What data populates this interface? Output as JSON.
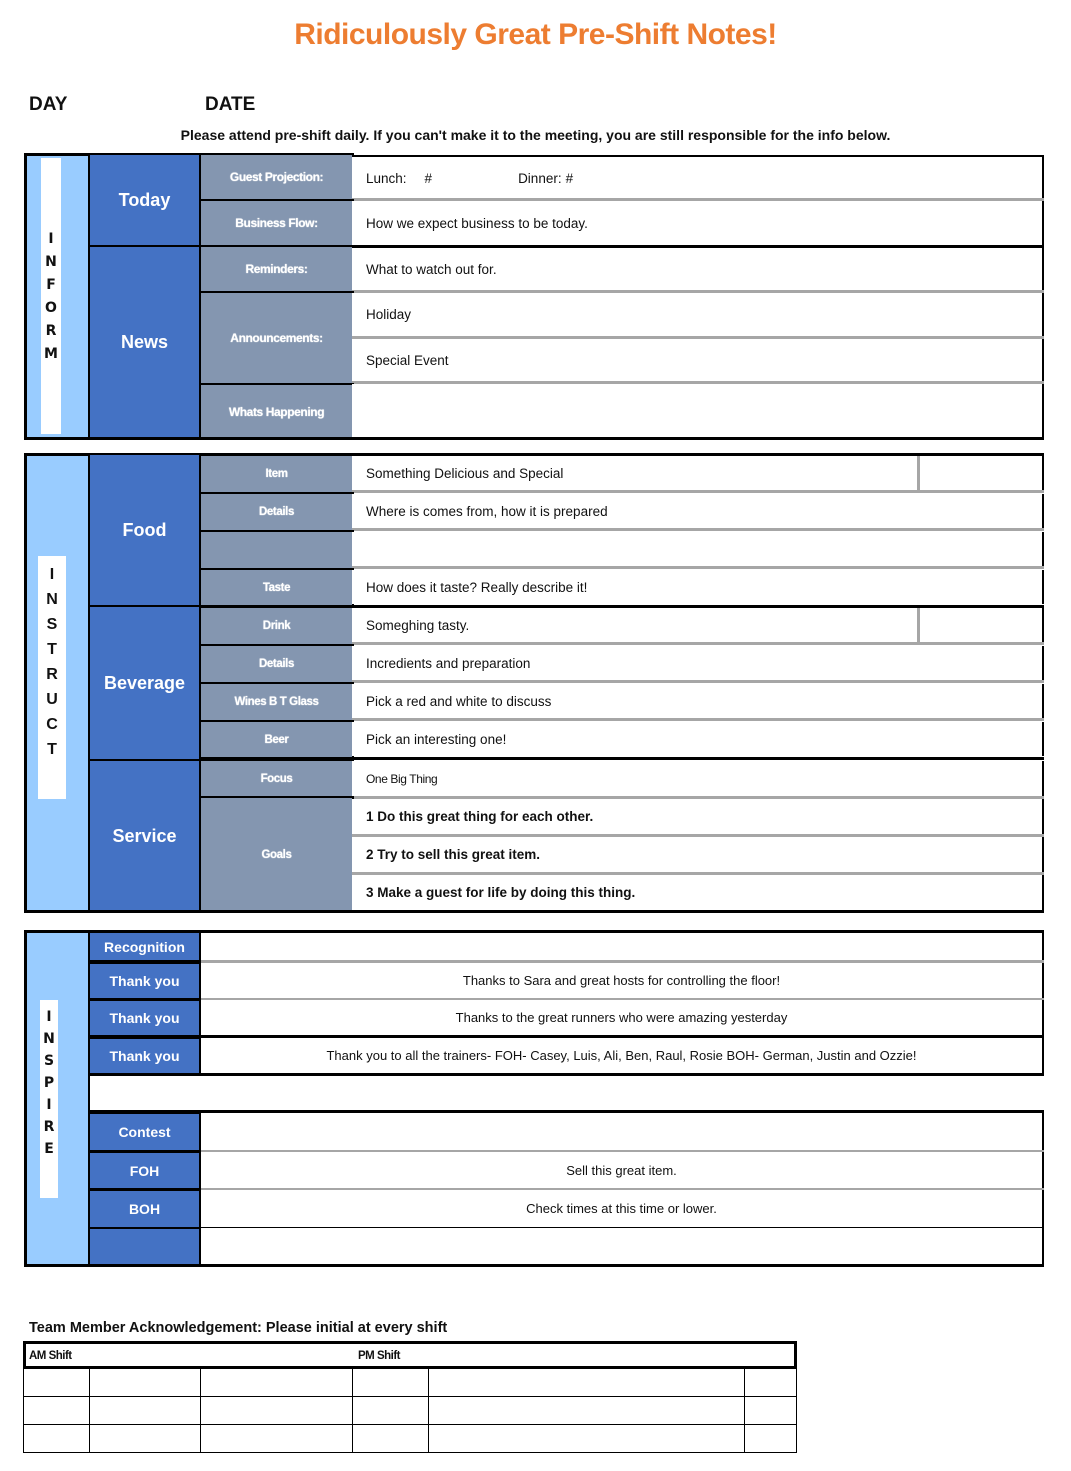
{
  "header": {
    "title": "Ridiculously Great Pre-Shift Notes!",
    "day_label": "DAY",
    "date_label": "DATE",
    "notice": "Please attend pre-shift daily.  If you can't make it to the meeting, you are still responsible for the info below."
  },
  "colors": {
    "title_orange": "#ed7d31",
    "category_blue": "#4472c4",
    "subcategory_slate": "#8496b0",
    "side_light_blue": "#99ccff"
  },
  "inform": {
    "side_label": [
      "I",
      "N",
      "F",
      "O",
      "R",
      "M"
    ],
    "today": {
      "label": "Today",
      "guest_projection_label": "Guest Projection:",
      "lunch_label": "Lunch:",
      "lunch_value": "#",
      "dinner_label": "Dinner:",
      "dinner_value": "#",
      "business_flow_label": "Business Flow:",
      "business_flow_value": "How we expect business to be today."
    },
    "news": {
      "label": "News",
      "reminders_label": "Reminders:",
      "reminders_value": "What to watch out for.",
      "announcements_label": "Announcements:",
      "announcements": [
        "Holiday",
        "Special Event"
      ],
      "whats_happening_label": "Whats Happening",
      "whats_happening_value": ""
    }
  },
  "instruct": {
    "side_label": [
      "I",
      "N",
      "S",
      "T",
      "R",
      "U",
      "C",
      "T"
    ],
    "food": {
      "label": "Food",
      "rows": [
        {
          "label": "Item",
          "value": "Something Delicious and Special"
        },
        {
          "label": "Details",
          "value": "Where is comes from, how it is prepared"
        },
        {
          "label": "",
          "value": ""
        },
        {
          "label": "Taste",
          "value": "How does it taste? Really describe it!"
        }
      ]
    },
    "beverage": {
      "label": "Beverage",
      "rows": [
        {
          "label": "Drink",
          "value": "Someghing tasty."
        },
        {
          "label": "Details",
          "value": "Incredients and preparation"
        },
        {
          "label": "Wines B T Glass",
          "value": "Pick a red and white to discuss"
        },
        {
          "label": "Beer",
          "value": "Pick an interesting one!"
        }
      ]
    },
    "service": {
      "label": "Service",
      "focus_label": "Focus",
      "focus_value": "One Big Thing",
      "goals_label": "Goals",
      "goals": [
        "1  Do this great thing for each other.",
        "2 Try to sell this great item.",
        "3 Make a guest for life by doing this thing."
      ]
    }
  },
  "inspire": {
    "side_label": [
      "I",
      "N",
      "S",
      "P",
      "I",
      "R",
      "E"
    ],
    "recognition_label": "Recognition",
    "recognition_value": "",
    "thank_yous": [
      {
        "label": "Thank you",
        "value": "Thanks to Sara and great hosts for controlling the floor!"
      },
      {
        "label": "Thank you",
        "value": "Thanks to the great runners who were amazing yesterday"
      },
      {
        "label": "Thank you",
        "value": "Thank you to all the trainers- FOH- Casey, Luis, Ali, Ben, Raul, Rosie  BOH- German, Justin and Ozzie!"
      }
    ],
    "contest": [
      {
        "label": "Contest",
        "value": ""
      },
      {
        "label": "FOH",
        "value": "Sell this great item."
      },
      {
        "label": "BOH",
        "value": "Check times at this time or lower."
      },
      {
        "label": "",
        "value": ""
      }
    ]
  },
  "acknowledgement": {
    "title": "Team Member Acknowledgement: Please initial at every shift",
    "am_label": "AM Shift",
    "pm_label": "PM Shift",
    "rows": 3
  }
}
